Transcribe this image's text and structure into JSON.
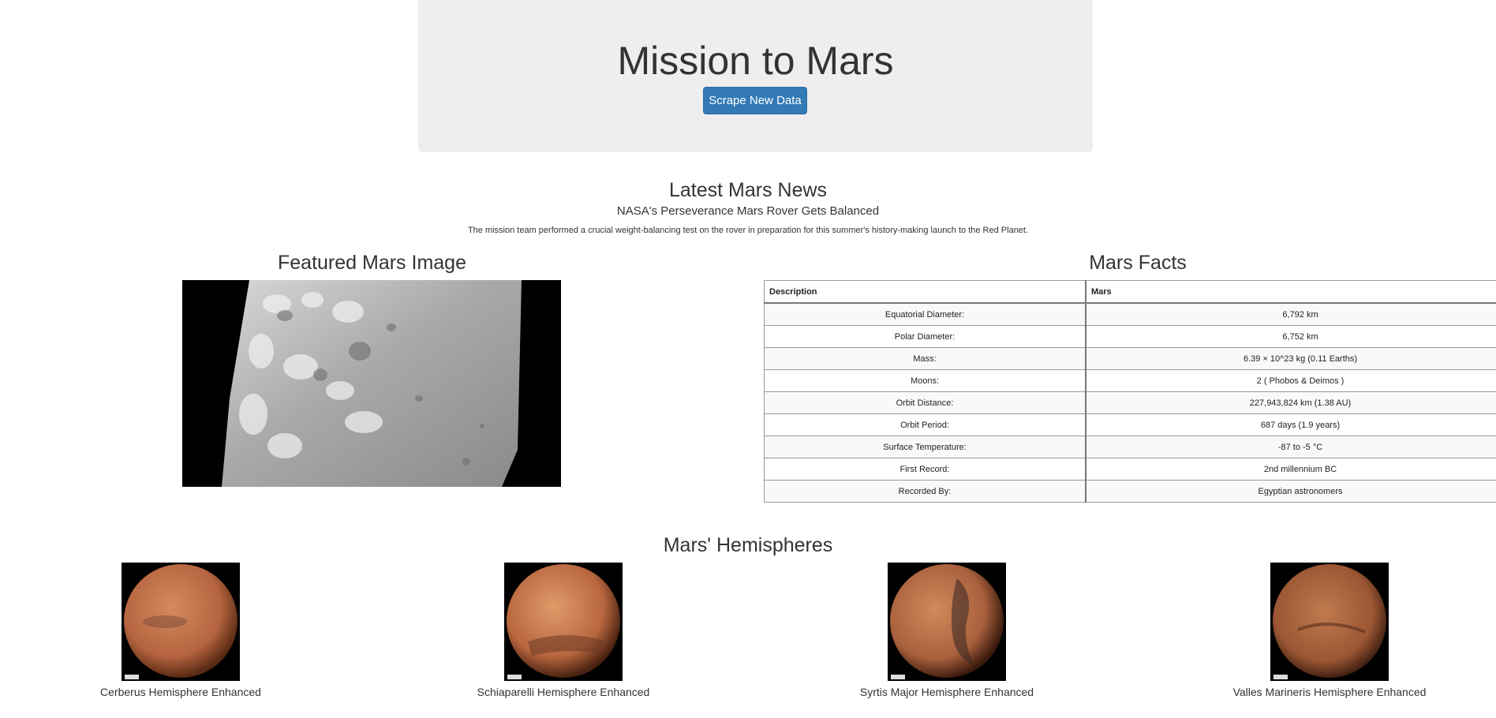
{
  "header": {
    "title": "Mission to Mars",
    "scrape_button_label": "Scrape New Data"
  },
  "news": {
    "section_title": "Latest Mars News",
    "headline": "NASA's Perseverance Mars Rover Gets Balanced",
    "paragraph": "The mission team performed a crucial weight-balancing test on the rover in preparation for this summer's history-making launch to the Red Planet."
  },
  "featured_image": {
    "section_title": "Featured Mars Image"
  },
  "facts": {
    "section_title": "Mars Facts",
    "columns": [
      "Description",
      "Mars"
    ],
    "rows": [
      [
        "Equatorial Diameter:",
        "6,792 km"
      ],
      [
        "Polar Diameter:",
        "6,752 km"
      ],
      [
        "Mass:",
        "6.39 × 10^23 kg (0.11 Earths)"
      ],
      [
        "Moons:",
        "2 ( Phobos & Deimos )"
      ],
      [
        "Orbit Distance:",
        "227,943,824 km (1.38 AU)"
      ],
      [
        "Orbit Period:",
        "687 days (1.9 years)"
      ],
      [
        "Surface Temperature:",
        "-87 to -5 °C"
      ],
      [
        "First Record:",
        "2nd millennium BC"
      ],
      [
        "Recorded By:",
        "Egyptian astronomers"
      ]
    ]
  },
  "hemispheres": {
    "section_title": "Mars' Hemispheres",
    "items": [
      {
        "title": "Cerberus Hemisphere Enhanced",
        "color": "#b5643f"
      },
      {
        "title": "Schiaparelli Hemisphere Enhanced",
        "color": "#b8663e"
      },
      {
        "title": "Syrtis Major Hemisphere Enhanced",
        "color": "#a9603d"
      },
      {
        "title": "Valles Marineris Hemisphere Enhanced",
        "color": "#9b5633"
      }
    ]
  }
}
